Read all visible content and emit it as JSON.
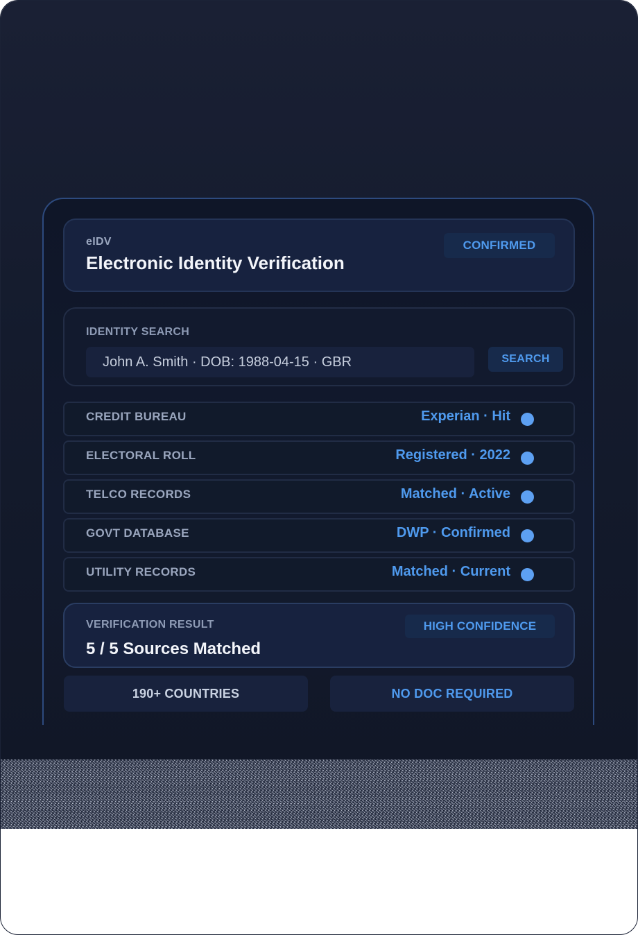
{
  "header": {
    "eyebrow": "eIDV",
    "title": "Electronic Identity Verification",
    "status_badge": "CONFIRMED"
  },
  "search": {
    "label": "IDENTITY SEARCH",
    "value": "John A. Smith · DOB: 1988-04-15 · GBR",
    "button_label": "SEARCH"
  },
  "sources": [
    {
      "label": "CREDIT BUREAU",
      "value": "Experian · Hit"
    },
    {
      "label": "ELECTORAL ROLL",
      "value": "Registered · 2022"
    },
    {
      "label": "TELCO RECORDS",
      "value": "Matched · Active"
    },
    {
      "label": "GOVT DATABASE",
      "value": "DWP · Confirmed"
    },
    {
      "label": "UTILITY RECORDS",
      "value": "Matched · Current"
    }
  ],
  "result": {
    "label": "VERIFICATION RESULT",
    "value": "5 / 5 Sources Matched",
    "badge": "HIGH CONFIDENCE"
  },
  "footer_chips": {
    "countries": "190+ COUNTRIES",
    "no_doc": "NO DOC REQUIRED"
  },
  "colors": {
    "accent": "#4f9aee",
    "background": "#151c2f",
    "panel": "#17223f"
  }
}
